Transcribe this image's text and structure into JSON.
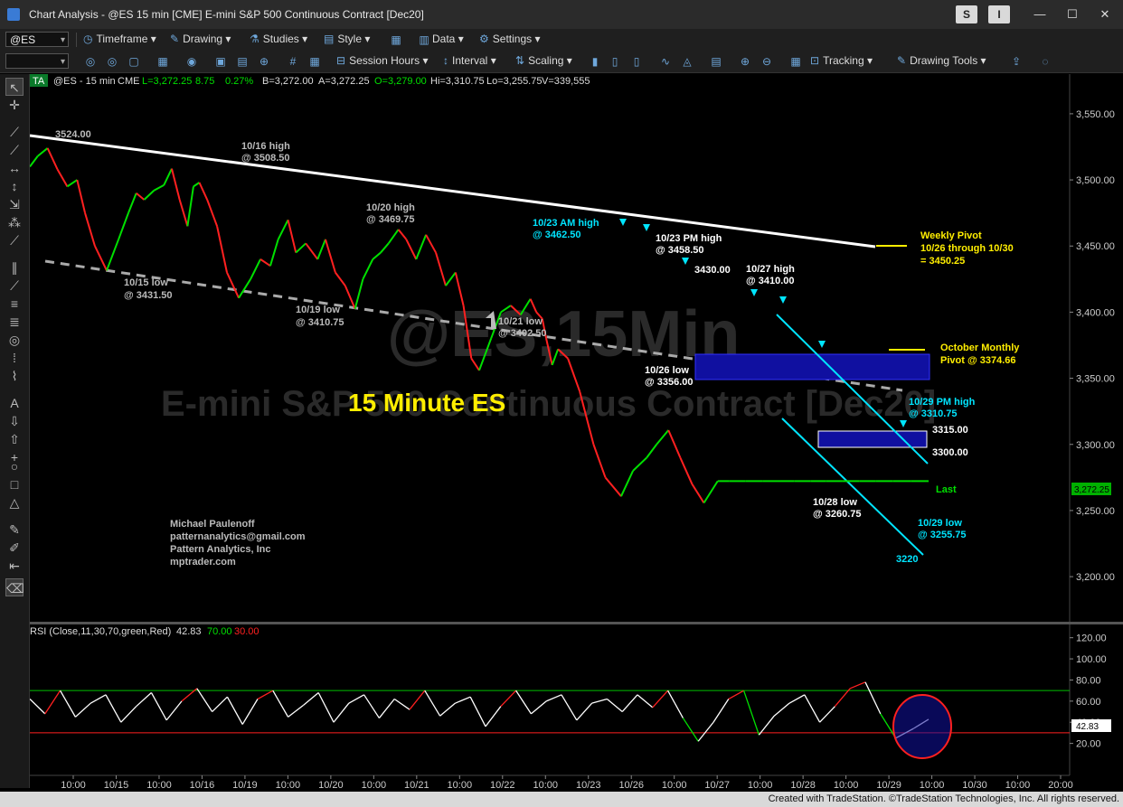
{
  "window": {
    "title": "Chart Analysis - @ES 15 min [CME] E-mini S&P 500 Continuous Contract [Dec20]",
    "s_button": "S",
    "i_button": "I",
    "minimize": "—",
    "maximize": "☐",
    "close": "✕"
  },
  "toolbar1": {
    "symbol": "@ES",
    "timeframe": "Timeframe",
    "drawing": "Drawing",
    "studies": "Studies",
    "style": "Style",
    "data": "Data",
    "settings": "Settings"
  },
  "toolbar2": {
    "session_hours": "Session Hours",
    "interval": "Interval",
    "scaling": "Scaling",
    "tracking": "Tracking",
    "drawing_tools": "Drawing Tools"
  },
  "header": {
    "badge": "TA",
    "symbol": "@ES - 15 min",
    "exchange": "CME",
    "last_label": "L=3,272.25",
    "change": "8.75",
    "pct": "0.27%",
    "bid": "B=3,272.00",
    "ask": "A=3,272.25",
    "open": "O=3,279.00",
    "high": "Hi=3,310.75",
    "low": "Lo=3,255.75",
    "volume": "V=339,555"
  },
  "watermark": {
    "line1": "@ES,15Min",
    "line2": "E-mini S&P 500 Continuous Contract [Dec20]"
  },
  "chart_data": {
    "type": "line",
    "title": "15 Minute ES",
    "price_axis": {
      "ticks": [
        "3,550.00",
        "3,500.00",
        "3,450.00",
        "3,400.00",
        "3,350.00",
        "3,300.00",
        "3,250.00",
        "3,200.00"
      ],
      "values": [
        3550,
        3500,
        3450,
        3400,
        3350,
        3300,
        3250,
        3200
      ],
      "ylim": [
        3170,
        3580
      ],
      "last_value": 3272.25,
      "last_label": "3,272.25"
    },
    "time_axis": {
      "ticks": [
        "10:00",
        "10/15",
        "10:00",
        "10/16",
        "10/19",
        "10:00",
        "10/20",
        "10:00",
        "10/21",
        "10:00",
        "10/22",
        "10:00",
        "10/23",
        "10/26",
        "10:00",
        "10/27",
        "10:00",
        "10/28",
        "10:00",
        "10/29",
        "10:00",
        "10/30",
        "10:00",
        "20:00"
      ]
    },
    "price_series": {
      "name": "@ES 15 min",
      "color_up": "#00e000",
      "color_down": "#ff2020",
      "x": [
        0,
        4,
        9,
        14,
        19,
        24,
        28,
        33,
        39,
        45,
        50,
        54,
        58,
        63,
        68,
        72,
        76,
        80,
        83,
        86,
        90,
        95,
        100,
        106,
        112,
        117,
        122,
        126,
        131,
        135,
        140,
        146,
        150,
        155,
        160,
        165,
        169,
        174,
        178,
        182,
        187,
        191,
        196,
        201,
        206,
        211,
        216,
        220,
        224,
        228,
        234,
        239,
        244,
        249,
        254,
        257,
        260,
        262,
        265,
        268,
        273,
        279,
        286,
        292,
        300,
        306,
        313,
        318,
        324,
        330,
        336,
        342,
        349,
        355,
        363,
        372,
        381,
        388,
        396,
        404,
        412,
        421,
        429,
        438,
        447,
        456
      ],
      "y": [
        3510,
        3518,
        3524,
        3508,
        3495,
        3500,
        3475,
        3450,
        3431.5,
        3455,
        3475,
        3490,
        3485,
        3492,
        3496,
        3508.5,
        3485,
        3465,
        3495,
        3498,
        3485,
        3465,
        3430,
        3410.75,
        3425,
        3440,
        3435,
        3455,
        3469.75,
        3445,
        3452,
        3440,
        3455,
        3430,
        3420,
        3402.5,
        3425,
        3440,
        3445,
        3452,
        3462.5,
        3455,
        3440,
        3458.5,
        3445,
        3420,
        3430,
        3405,
        3365,
        3356,
        3380,
        3400,
        3405,
        3398,
        3410,
        3400,
        3395,
        3380,
        3360,
        3372,
        3365,
        3340,
        3300,
        3275,
        3260.75,
        3280,
        3290,
        3300,
        3310.75,
        3290,
        3270,
        3255.75,
        3272.25,
        3272.25,
        3272.25,
        3272.25,
        3272.25,
        3272.25,
        3272.25,
        3272.25,
        3272.25,
        3272.25,
        3272.25,
        3272.25,
        3272.25,
        3272.25
      ]
    },
    "annotations": [
      {
        "text": "3524.00",
        "color": "#bbbbbb"
      },
      {
        "text": "10/16 high",
        "color": "#bbbbbb"
      },
      {
        "text": "@ 3508.50",
        "color": "#bbbbbb"
      },
      {
        "text": "10/20 high",
        "color": "#bbbbbb"
      },
      {
        "text": "@ 3469.75",
        "color": "#bbbbbb"
      },
      {
        "text": "10/15 low",
        "color": "#bbbbbb"
      },
      {
        "text": "@ 3431.50",
        "color": "#bbbbbb"
      },
      {
        "text": "10/19 low",
        "color": "#bbbbbb"
      },
      {
        "text": "@ 3410.75",
        "color": "#bbbbbb"
      },
      {
        "text": "10/21 low",
        "color": "#bbbbbb"
      },
      {
        "text": "@ 3402.50",
        "color": "#bbbbbb"
      },
      {
        "text": "10/23 AM high",
        "color": "#00e5ff"
      },
      {
        "text": "@ 3462.50",
        "color": "#00e5ff"
      },
      {
        "text": "10/23 PM high",
        "color": "#ffffff"
      },
      {
        "text": "@ 3458.50",
        "color": "#ffffff"
      },
      {
        "text": "3430.00",
        "color": "#ffffff"
      },
      {
        "text": "10/27 high",
        "color": "#ffffff"
      },
      {
        "text": "@ 3410.00",
        "color": "#ffffff"
      },
      {
        "text": "10/26 low",
        "color": "#ffffff"
      },
      {
        "text": "@ 3356.00",
        "color": "#ffffff"
      },
      {
        "text": "10/29 PM high",
        "color": "#00e5ff"
      },
      {
        "text": "@ 3310.75",
        "color": "#00e5ff"
      },
      {
        "text": "3315.00",
        "color": "#ffffff"
      },
      {
        "text": "3300.00",
        "color": "#ffffff"
      },
      {
        "text": "10/28 low",
        "color": "#ffffff"
      },
      {
        "text": "@ 3260.75",
        "color": "#ffffff"
      },
      {
        "text": "10/29 low",
        "color": "#00e5ff"
      },
      {
        "text": "@ 3255.75",
        "color": "#00e5ff"
      },
      {
        "text": "3220",
        "color": "#00e5ff"
      },
      {
        "text": "Last",
        "color": "#00e000"
      },
      {
        "text": "Weekly Pivot",
        "color": "#ffee00"
      },
      {
        "text": "10/26 through 10/30",
        "color": "#ffee00"
      },
      {
        "text": "= 3450.25",
        "color": "#ffee00"
      },
      {
        "text": "October Monthly",
        "color": "#ffee00"
      },
      {
        "text": "Pivot @ 3374.66",
        "color": "#ffee00"
      },
      {
        "text": "Michael Paulenoff",
        "color": "#bbbbbb"
      },
      {
        "text": "patternanalytics@gmail.com",
        "color": "#bbbbbb"
      },
      {
        "text": "Pattern Analytics, Inc",
        "color": "#bbbbbb"
      },
      {
        "text": "mptrader.com",
        "color": "#bbbbbb"
      }
    ],
    "rsi": {
      "label": "RSI (Close,11,30,70,green,Red)",
      "value": "42.83",
      "overbought": "70.00",
      "oversold": "30.00",
      "ticks": [
        "120.00",
        "100.00",
        "80.00",
        "60.00",
        "40.00",
        "20.00"
      ],
      "tick_values": [
        120,
        100,
        80,
        60,
        40,
        20
      ],
      "ylim": [
        0,
        130
      ],
      "last_label": "42.83",
      "x": [
        0,
        6,
        12,
        18,
        24,
        30,
        36,
        42,
        48,
        54,
        60,
        66,
        72,
        78,
        84,
        90,
        96,
        102,
        108,
        114,
        120,
        126,
        132,
        138,
        144,
        150,
        156,
        162,
        168,
        174,
        180,
        186,
        192,
        198,
        204,
        210,
        216,
        222,
        228,
        234,
        240,
        246,
        252,
        258,
        264,
        270,
        276,
        282,
        288,
        294,
        300,
        306,
        312,
        318,
        324,
        330,
        336,
        342,
        349,
        355
      ],
      "y": [
        62,
        48,
        70,
        45,
        58,
        66,
        40,
        55,
        68,
        42,
        60,
        72,
        50,
        64,
        38,
        62,
        70,
        45,
        56,
        68,
        40,
        58,
        66,
        44,
        62,
        52,
        70,
        46,
        58,
        64,
        36,
        55,
        70,
        48,
        60,
        66,
        42,
        58,
        62,
        50,
        66,
        54,
        70,
        44,
        22,
        40,
        62,
        70,
        28,
        46,
        58,
        66,
        40,
        55,
        72,
        78,
        48,
        25,
        34,
        42.83
      ]
    }
  },
  "footer": "Created with TradeStation. ©TradeStation Technologies, Inc. All rights reserved."
}
